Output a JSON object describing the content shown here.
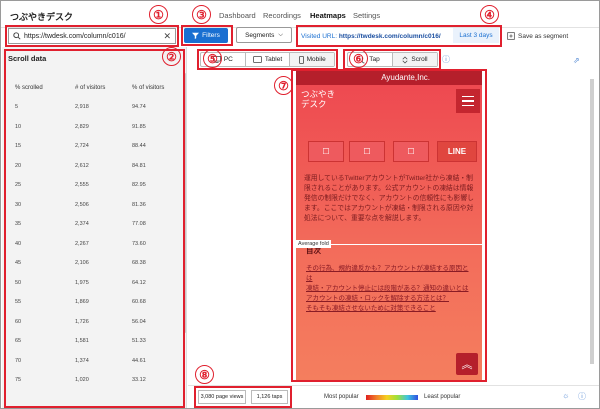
{
  "app": {
    "title": "つぶやきデスク"
  },
  "nav": {
    "tabs": [
      "Dashboard",
      "Recordings",
      "Heatmaps",
      "Settings"
    ],
    "active": "Heatmaps"
  },
  "search": {
    "value": "https://twdesk.com/column/c016/",
    "clear": "✕"
  },
  "toolbar": {
    "filters_label": "Filters",
    "segments_label": "Segments",
    "visited_prefix": "Visited URL:",
    "visited_url": "https://twdesk.com/column/c016/",
    "date_range": "Last 3 days",
    "save_segment": "Save as segment"
  },
  "devices": {
    "tabs": [
      "PC",
      "Tablet",
      "Mobile"
    ],
    "active": "Mobile"
  },
  "modes": {
    "tabs": [
      "Tap",
      "Scroll"
    ],
    "active": "Scroll"
  },
  "sidebar": {
    "title": "Scroll data",
    "columns": [
      "% scrolled",
      "# of visitors",
      "% of visitors"
    ],
    "rows": [
      [
        "5",
        "2,918",
        "94.74"
      ],
      [
        "10",
        "2,829",
        "91.85"
      ],
      [
        "15",
        "2,724",
        "88.44"
      ],
      [
        "20",
        "2,612",
        "84.81"
      ],
      [
        "25",
        "2,555",
        "82.95"
      ],
      [
        "30",
        "2,506",
        "81.36"
      ],
      [
        "35",
        "2,374",
        "77.08"
      ],
      [
        "40",
        "2,267",
        "73.60"
      ],
      [
        "45",
        "2,106",
        "68.38"
      ],
      [
        "50",
        "1,975",
        "64.12"
      ],
      [
        "55",
        "1,869",
        "60.68"
      ],
      [
        "60",
        "1,726",
        "56.04"
      ],
      [
        "65",
        "1,581",
        "51.33"
      ],
      [
        "70",
        "1,374",
        "44.61"
      ],
      [
        "75",
        "1,020",
        "33.12"
      ]
    ]
  },
  "heatmap": {
    "site_header": "Ayudante,Inc.",
    "site_logo_line1": "つぶやき",
    "site_logo_line2": "デスク",
    "share_line": "LINE",
    "body_text": "運用しているTwitterアカウントがTwitter社から凍結・制限されることがあります。公式アカウントの凍結は情報発信の制限だけでなく、アカウントの信頼性にも影響します。ここではアカウントが凍結・制限される原因や対処法について、重要な点を解説します。",
    "avg_fold": "Average fold",
    "toc_title": "目次",
    "toc_items": [
      "その行為、規約違反かも？アカウントが凍結する原因とは",
      "凍結・アカウント停止には段階がある？通知の違いとは",
      "アカウントの凍結・ロックを解除する方法とは？",
      "そもそも凍結させないために対策できること"
    ],
    "page_top": "︽"
  },
  "footer": {
    "page_views": "3,080 page views",
    "taps": "1,126 taps",
    "most_popular": "Most popular",
    "least_popular": "Least popular"
  },
  "annotations": [
    "①",
    "②",
    "③",
    "④",
    "⑤",
    "⑥",
    "⑦",
    "⑧"
  ],
  "colors": {
    "accent": "#1a6fd1",
    "annotation": "#e0202e",
    "heat_header": "#b51f2b"
  }
}
